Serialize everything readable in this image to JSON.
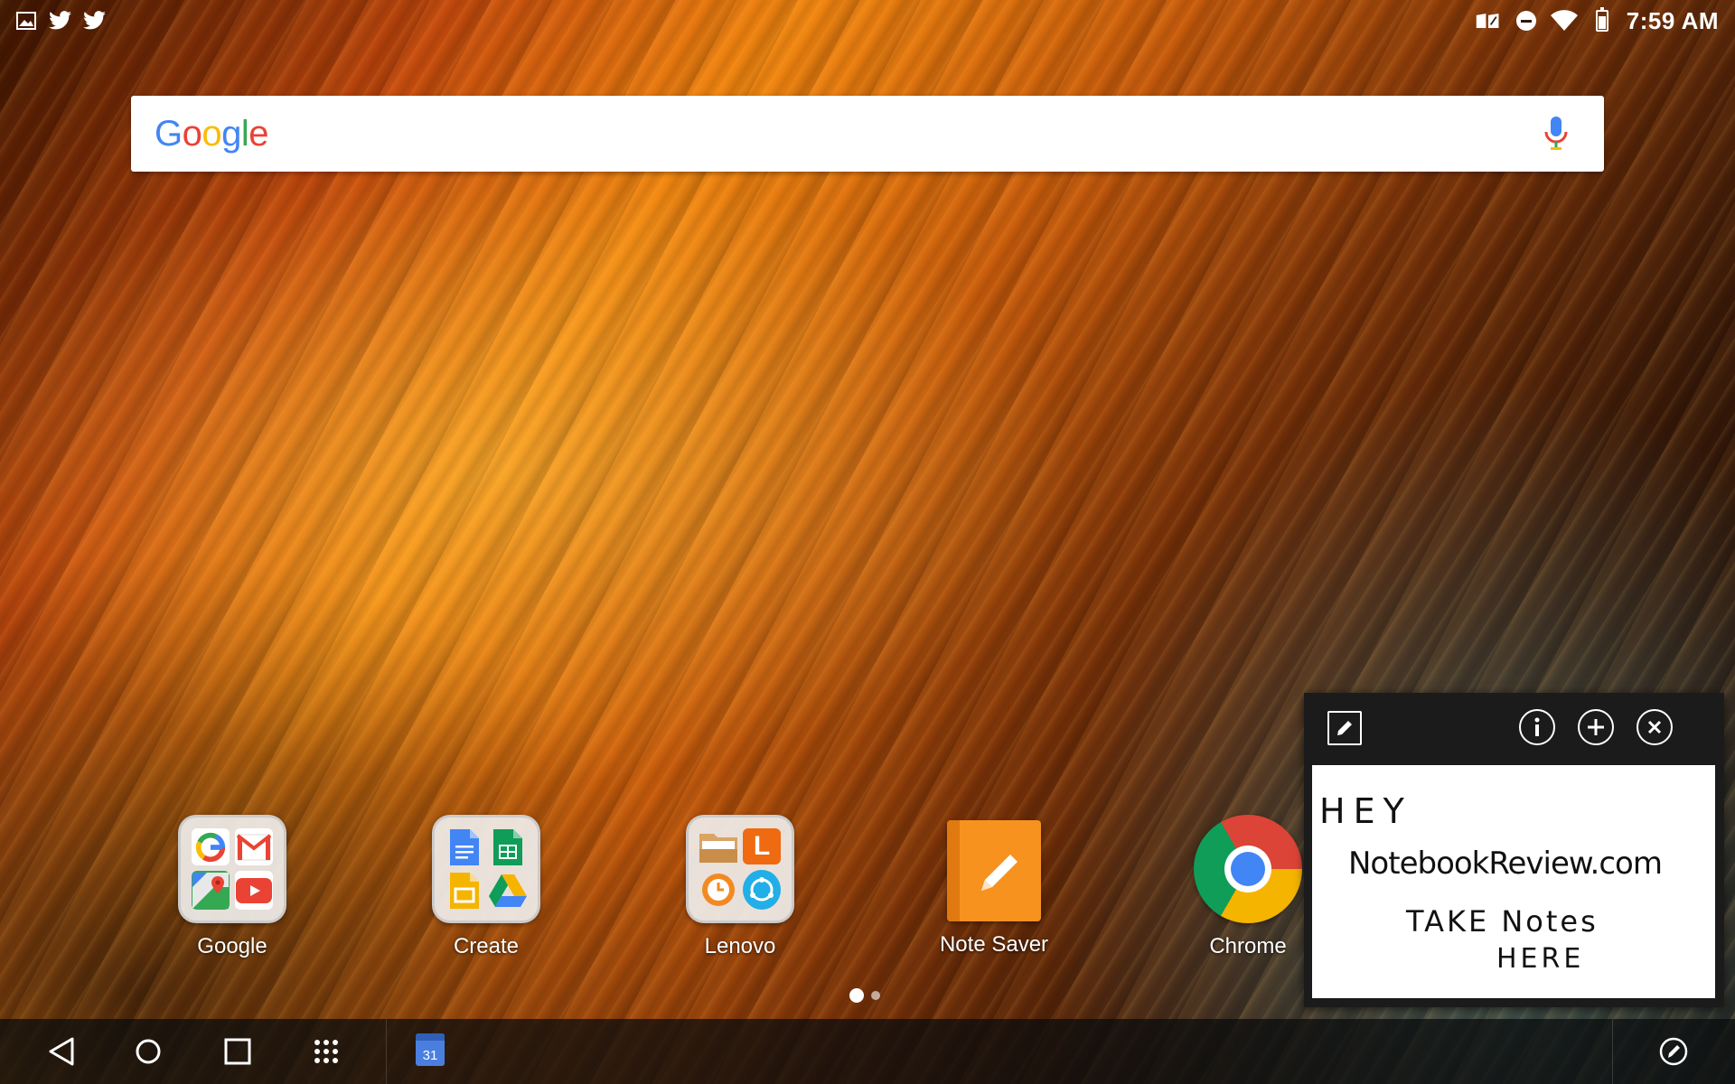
{
  "status_bar": {
    "time": "7:59 AM",
    "left_icons": [
      "image-icon",
      "twitter-icon",
      "twitter-icon"
    ],
    "right_icons": [
      "nfc-icon",
      "do-not-disturb-icon",
      "wifi-icon",
      "battery-icon"
    ]
  },
  "search": {
    "logo_letters": [
      {
        "ch": "G",
        "color": "#4285F4"
      },
      {
        "ch": "o",
        "color": "#EA4335"
      },
      {
        "ch": "o",
        "color": "#FBBC05"
      },
      {
        "ch": "g",
        "color": "#4285F4"
      },
      {
        "ch": "l",
        "color": "#34A853"
      },
      {
        "ch": "e",
        "color": "#EA4335"
      }
    ],
    "voice_icon": "mic-icon"
  },
  "apps": [
    {
      "label": "Google",
      "type": "folder"
    },
    {
      "label": "Create",
      "type": "folder"
    },
    {
      "label": "Lenovo",
      "type": "folder"
    },
    {
      "label": "Note Saver",
      "type": "app"
    },
    {
      "label": "Chrome",
      "type": "app"
    }
  ],
  "folders": {
    "google": [
      "google-icon",
      "gmail-icon",
      "maps-icon",
      "youtube-icon"
    ],
    "create": [
      "docs-icon",
      "sheets-icon",
      "slides-icon",
      "drive-icon"
    ],
    "lenovo": [
      "file-manager-icon",
      "lenovo-l-icon",
      "clock-icon",
      "share-icon"
    ]
  },
  "page_indicator": {
    "pages": 2,
    "current": 1
  },
  "note_widget": {
    "handwriting": [
      "HEY",
      "NotebookReview.com",
      "TAKE Notes",
      "HERE"
    ],
    "tools": [
      "pen-icon",
      "info-icon",
      "add-icon",
      "close-icon"
    ]
  },
  "nav_bar": {
    "buttons": [
      "back-icon",
      "home-icon",
      "recents-icon",
      "app-drawer-icon"
    ],
    "pinned": {
      "icon": "calendar-icon",
      "text": "31"
    },
    "right_icon": "stylus-icon"
  },
  "colors": {
    "google_blue": "#4285F4",
    "google_red": "#EA4335",
    "google_yellow": "#FBBC05",
    "google_green": "#34A853",
    "note_saver_orange": "#F7921E"
  }
}
